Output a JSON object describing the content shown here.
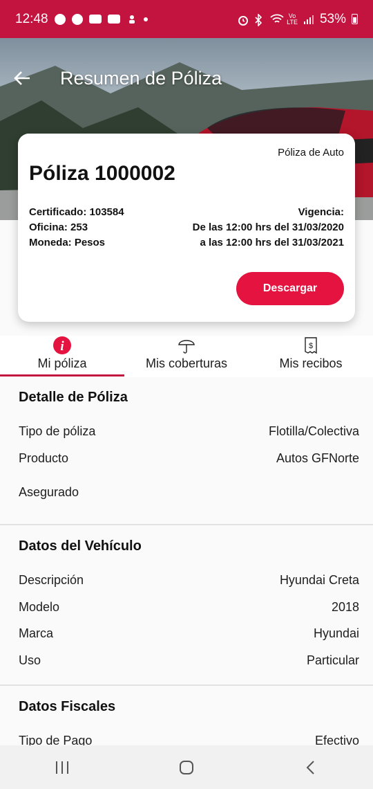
{
  "status_bar": {
    "time": "12:48",
    "battery": "53%"
  },
  "header": {
    "title": "Resumen de Póliza"
  },
  "card": {
    "type": "Póliza de Auto",
    "number": "Póliza 1000002",
    "certificate": "Certificado: 103584",
    "office": "Oficina: 253",
    "currency": "Moneda: Pesos",
    "validity_label": "Vigencia:",
    "validity_from": "De las 12:00 hrs del 31/03/2020",
    "validity_to": "a las 12:00 hrs del 31/03/2021",
    "download_label": "Descargar"
  },
  "tabs": [
    {
      "label": "Mi póliza",
      "icon": "info-icon",
      "active": true
    },
    {
      "label": "Mis coberturas",
      "icon": "umbrella-icon",
      "active": false
    },
    {
      "label": "Mis recibos",
      "icon": "receipt-icon",
      "active": false
    }
  ],
  "detalle": {
    "title": "Detalle de Póliza",
    "rows": [
      {
        "label": "Tipo de póliza",
        "value": "Flotilla/Colectiva"
      },
      {
        "label": "Producto",
        "value": "Autos GFNorte"
      },
      {
        "label": "Asegurado",
        "value": ""
      }
    ]
  },
  "vehiculo": {
    "title": "Datos del Vehículo",
    "rows": [
      {
        "label": "Descripción",
        "value": "Hyundai Creta"
      },
      {
        "label": "Modelo",
        "value": "2018"
      },
      {
        "label": "Marca",
        "value": "Hyundai"
      },
      {
        "label": "Uso",
        "value": "Particular"
      }
    ]
  },
  "fiscales": {
    "title": "Datos Fiscales",
    "rows": [
      {
        "label": "Tipo de Pago",
        "value": "Efectivo"
      }
    ]
  },
  "colors": {
    "brand": "#c3133f",
    "button": "#e4133f"
  }
}
